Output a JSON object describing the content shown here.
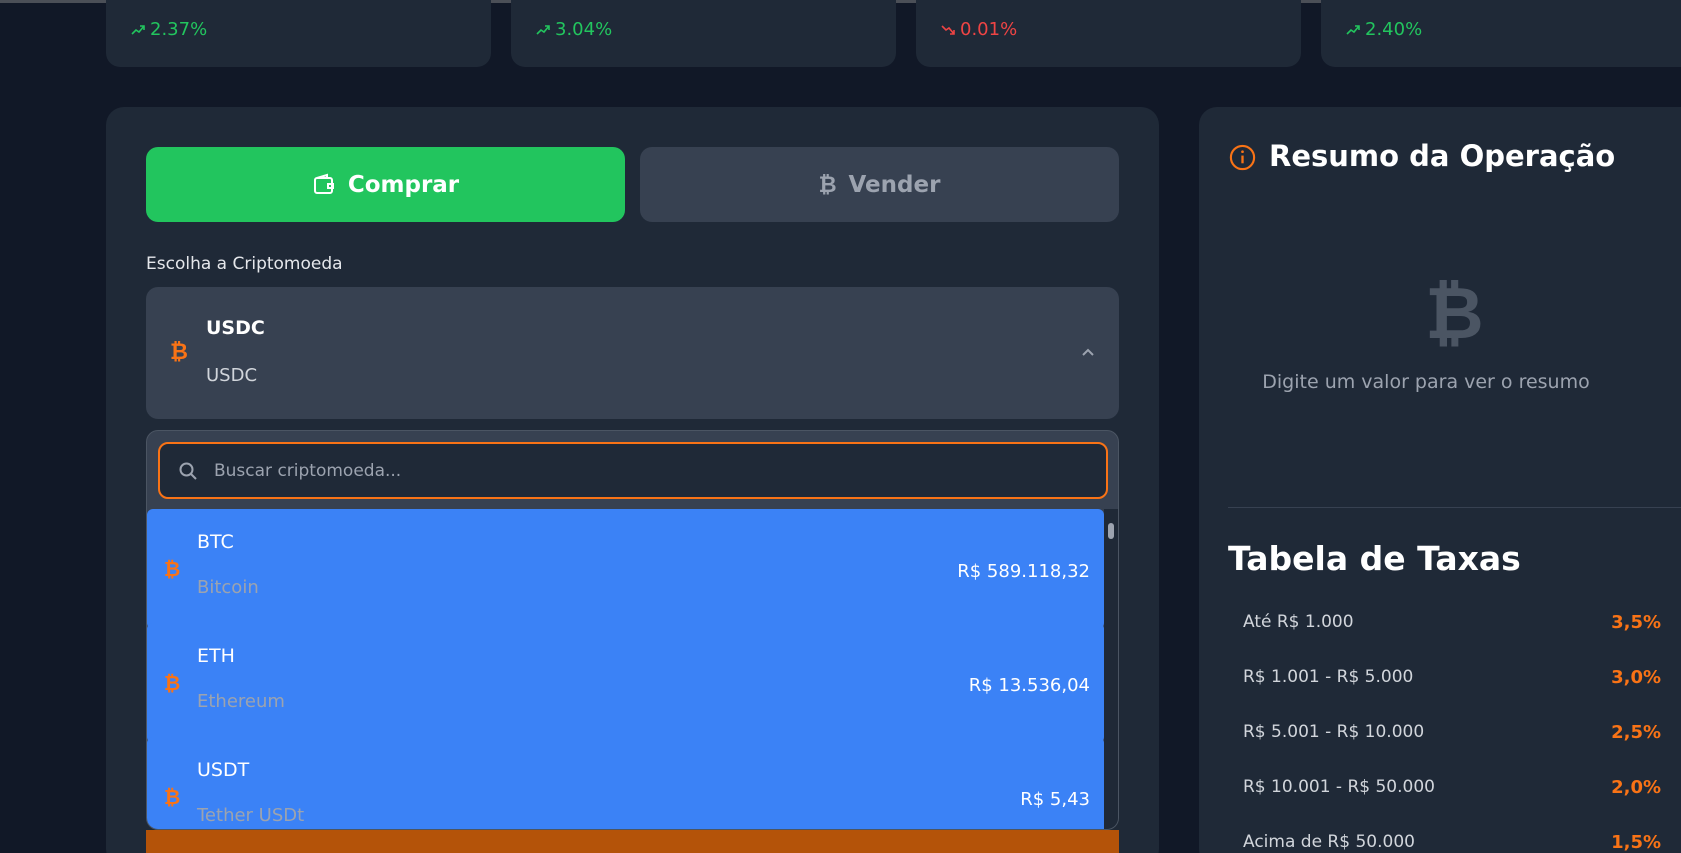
{
  "stats": [
    {
      "pct": "2.37%",
      "trend": "up"
    },
    {
      "pct": "3.04%",
      "trend": "up"
    },
    {
      "pct": "0.01%",
      "trend": "down"
    },
    {
      "pct": "2.40%",
      "trend": "up"
    }
  ],
  "trade": {
    "buy_label": "Comprar",
    "sell_label": "Vender",
    "crypto_label": "Escolha a Criptomoeda",
    "selected": {
      "symbol": "USDC",
      "name": "USDC"
    },
    "search_placeholder": "Buscar criptomoeda...",
    "coins": [
      {
        "symbol": "BTC",
        "name": "Bitcoin",
        "price": "R$ 589.118,32"
      },
      {
        "symbol": "ETH",
        "name": "Ethereum",
        "price": "R$ 13.536,04"
      },
      {
        "symbol": "USDT",
        "name": "Tether USDt",
        "price": "R$ 5,43"
      }
    ]
  },
  "summary": {
    "title": "Resumo da Operação",
    "empty_text": "Digite um valor para ver o resumo"
  },
  "rates": {
    "title": "Tabela de Taxas",
    "rows": [
      {
        "range": "Até R$ 1.000",
        "fee": "3,5%"
      },
      {
        "range": "R$ 1.001 - R$ 5.000",
        "fee": "3,0%"
      },
      {
        "range": "R$ 5.001 - R$ 10.000",
        "fee": "2,5%"
      },
      {
        "range": "R$ 10.001 - R$ 50.000",
        "fee": "2,0%"
      },
      {
        "range": "Acima de R$ 50.000",
        "fee": "1,5%"
      }
    ]
  },
  "colors": {
    "accent": "#f97316",
    "buy": "#22c55e",
    "up": "#22c55e",
    "down": "#ef4444",
    "selected_row": "#3b82f6"
  },
  "icons": {
    "buy": "wallet-icon",
    "sell": "bitcoin-icon",
    "search": "search-icon",
    "info": "info-icon",
    "trend_up": "trend-up-icon",
    "trend_down": "trend-down-icon"
  }
}
